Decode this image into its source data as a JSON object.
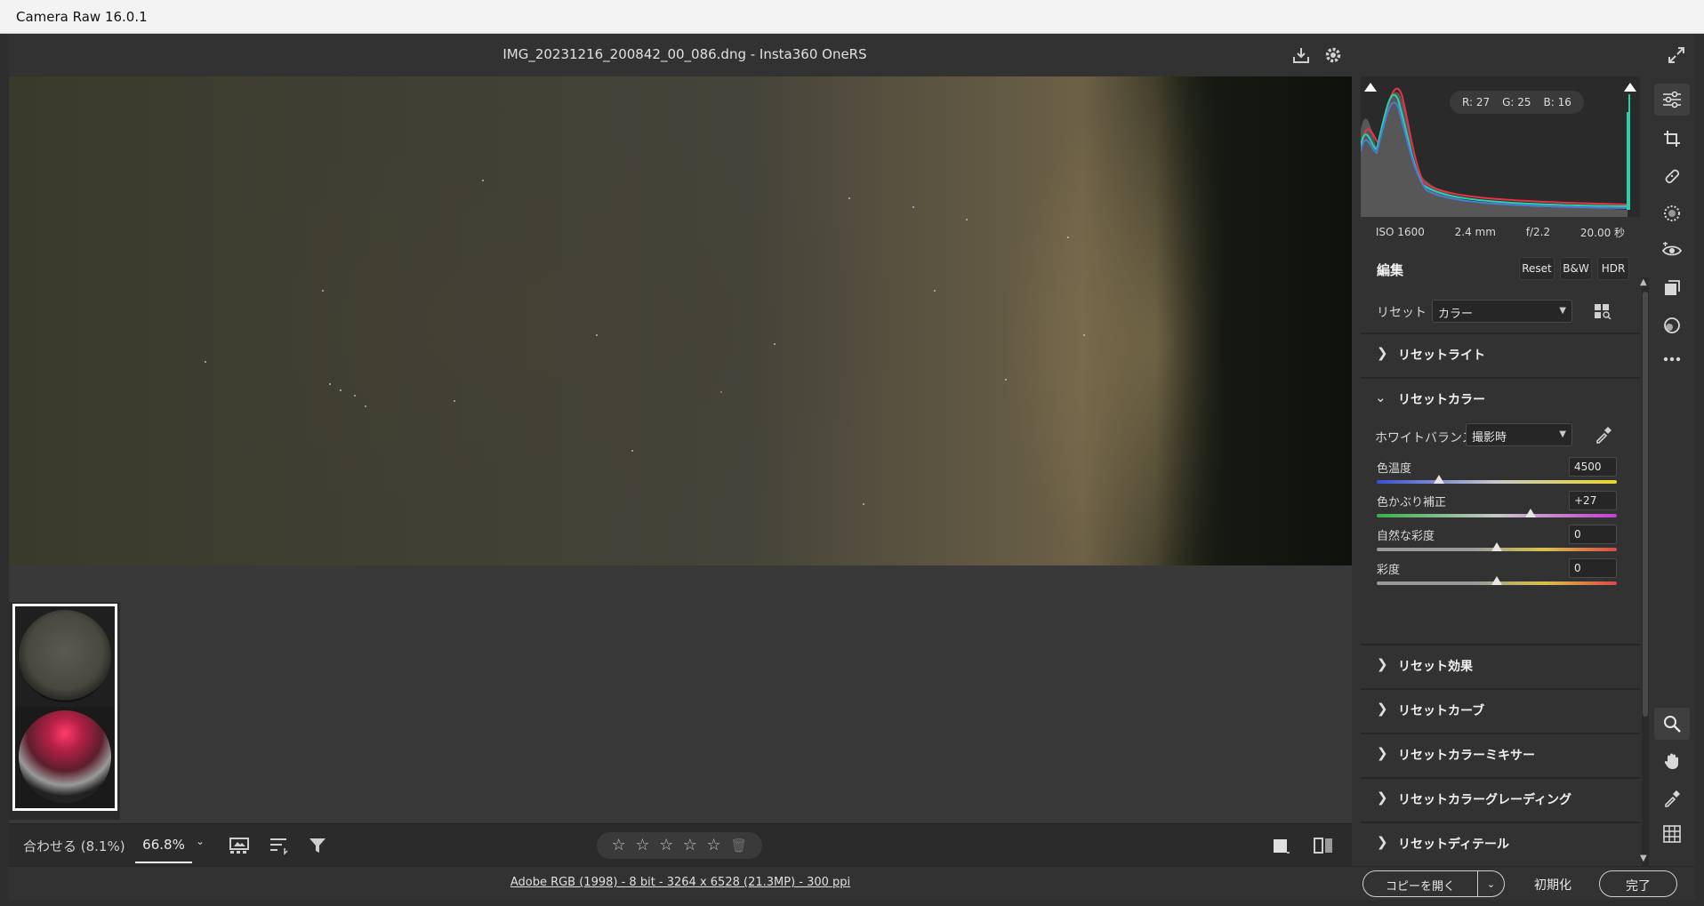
{
  "os_window": {
    "title": "Camera Raw 16.0.1"
  },
  "header": {
    "file_title": "IMG_20231216_200842_00_086.dng  -  Insta360 OneRS"
  },
  "icons": {
    "save": "download-icon",
    "settings": "gear-icon",
    "fullscreen": "expand-icon"
  },
  "toolbar": {
    "zoom_fit": "合わせる (8.1%)",
    "zoom_level": "66.8%",
    "rating_stars": 5
  },
  "status": {
    "color_info": "Adobe RGB (1998) - 8 bit - 3264 x 6528 (21.3MP) - 300 ppi",
    "open_copy": "コピーを開く",
    "reset": "初期化",
    "done": "完了"
  },
  "histogram": {
    "readout": {
      "r": "R: 27",
      "g": "G: 25",
      "b": "B: 16"
    }
  },
  "exif": {
    "iso": "ISO 1600",
    "focal": "2.4 mm",
    "aperture": "f/2.2",
    "shutter": "20.00 秒"
  },
  "edit": {
    "title": "編集",
    "buttons": {
      "reset": "Reset",
      "bw": "B&W",
      "hdr": "HDR"
    },
    "preset_label": "リセット",
    "preset_value": "カラー"
  },
  "sections": {
    "light": "リセットライト",
    "color": "リセットカラー",
    "effects": "リセット効果",
    "curve": "リセットカーブ",
    "mixer": "リセットカラーミキサー",
    "grading": "リセットカラーグレーディング",
    "detail": "リセットディテール"
  },
  "color_panel": {
    "wb_label": "ホワイトバランス",
    "wb_value": "撮影時",
    "sliders": [
      {
        "label": "色温度",
        "value": "4500",
        "position": 0.26
      },
      {
        "label": "色かぶり補正",
        "value": "+27",
        "position": 0.64
      },
      {
        "label": "自然な彩度",
        "value": "0",
        "position": 0.5
      },
      {
        "label": "彩度",
        "value": "0",
        "position": 0.5
      }
    ]
  },
  "colors": {
    "panel_bg": "#323232",
    "text": "#d4d4d4",
    "accent_white": "#ffffff"
  }
}
